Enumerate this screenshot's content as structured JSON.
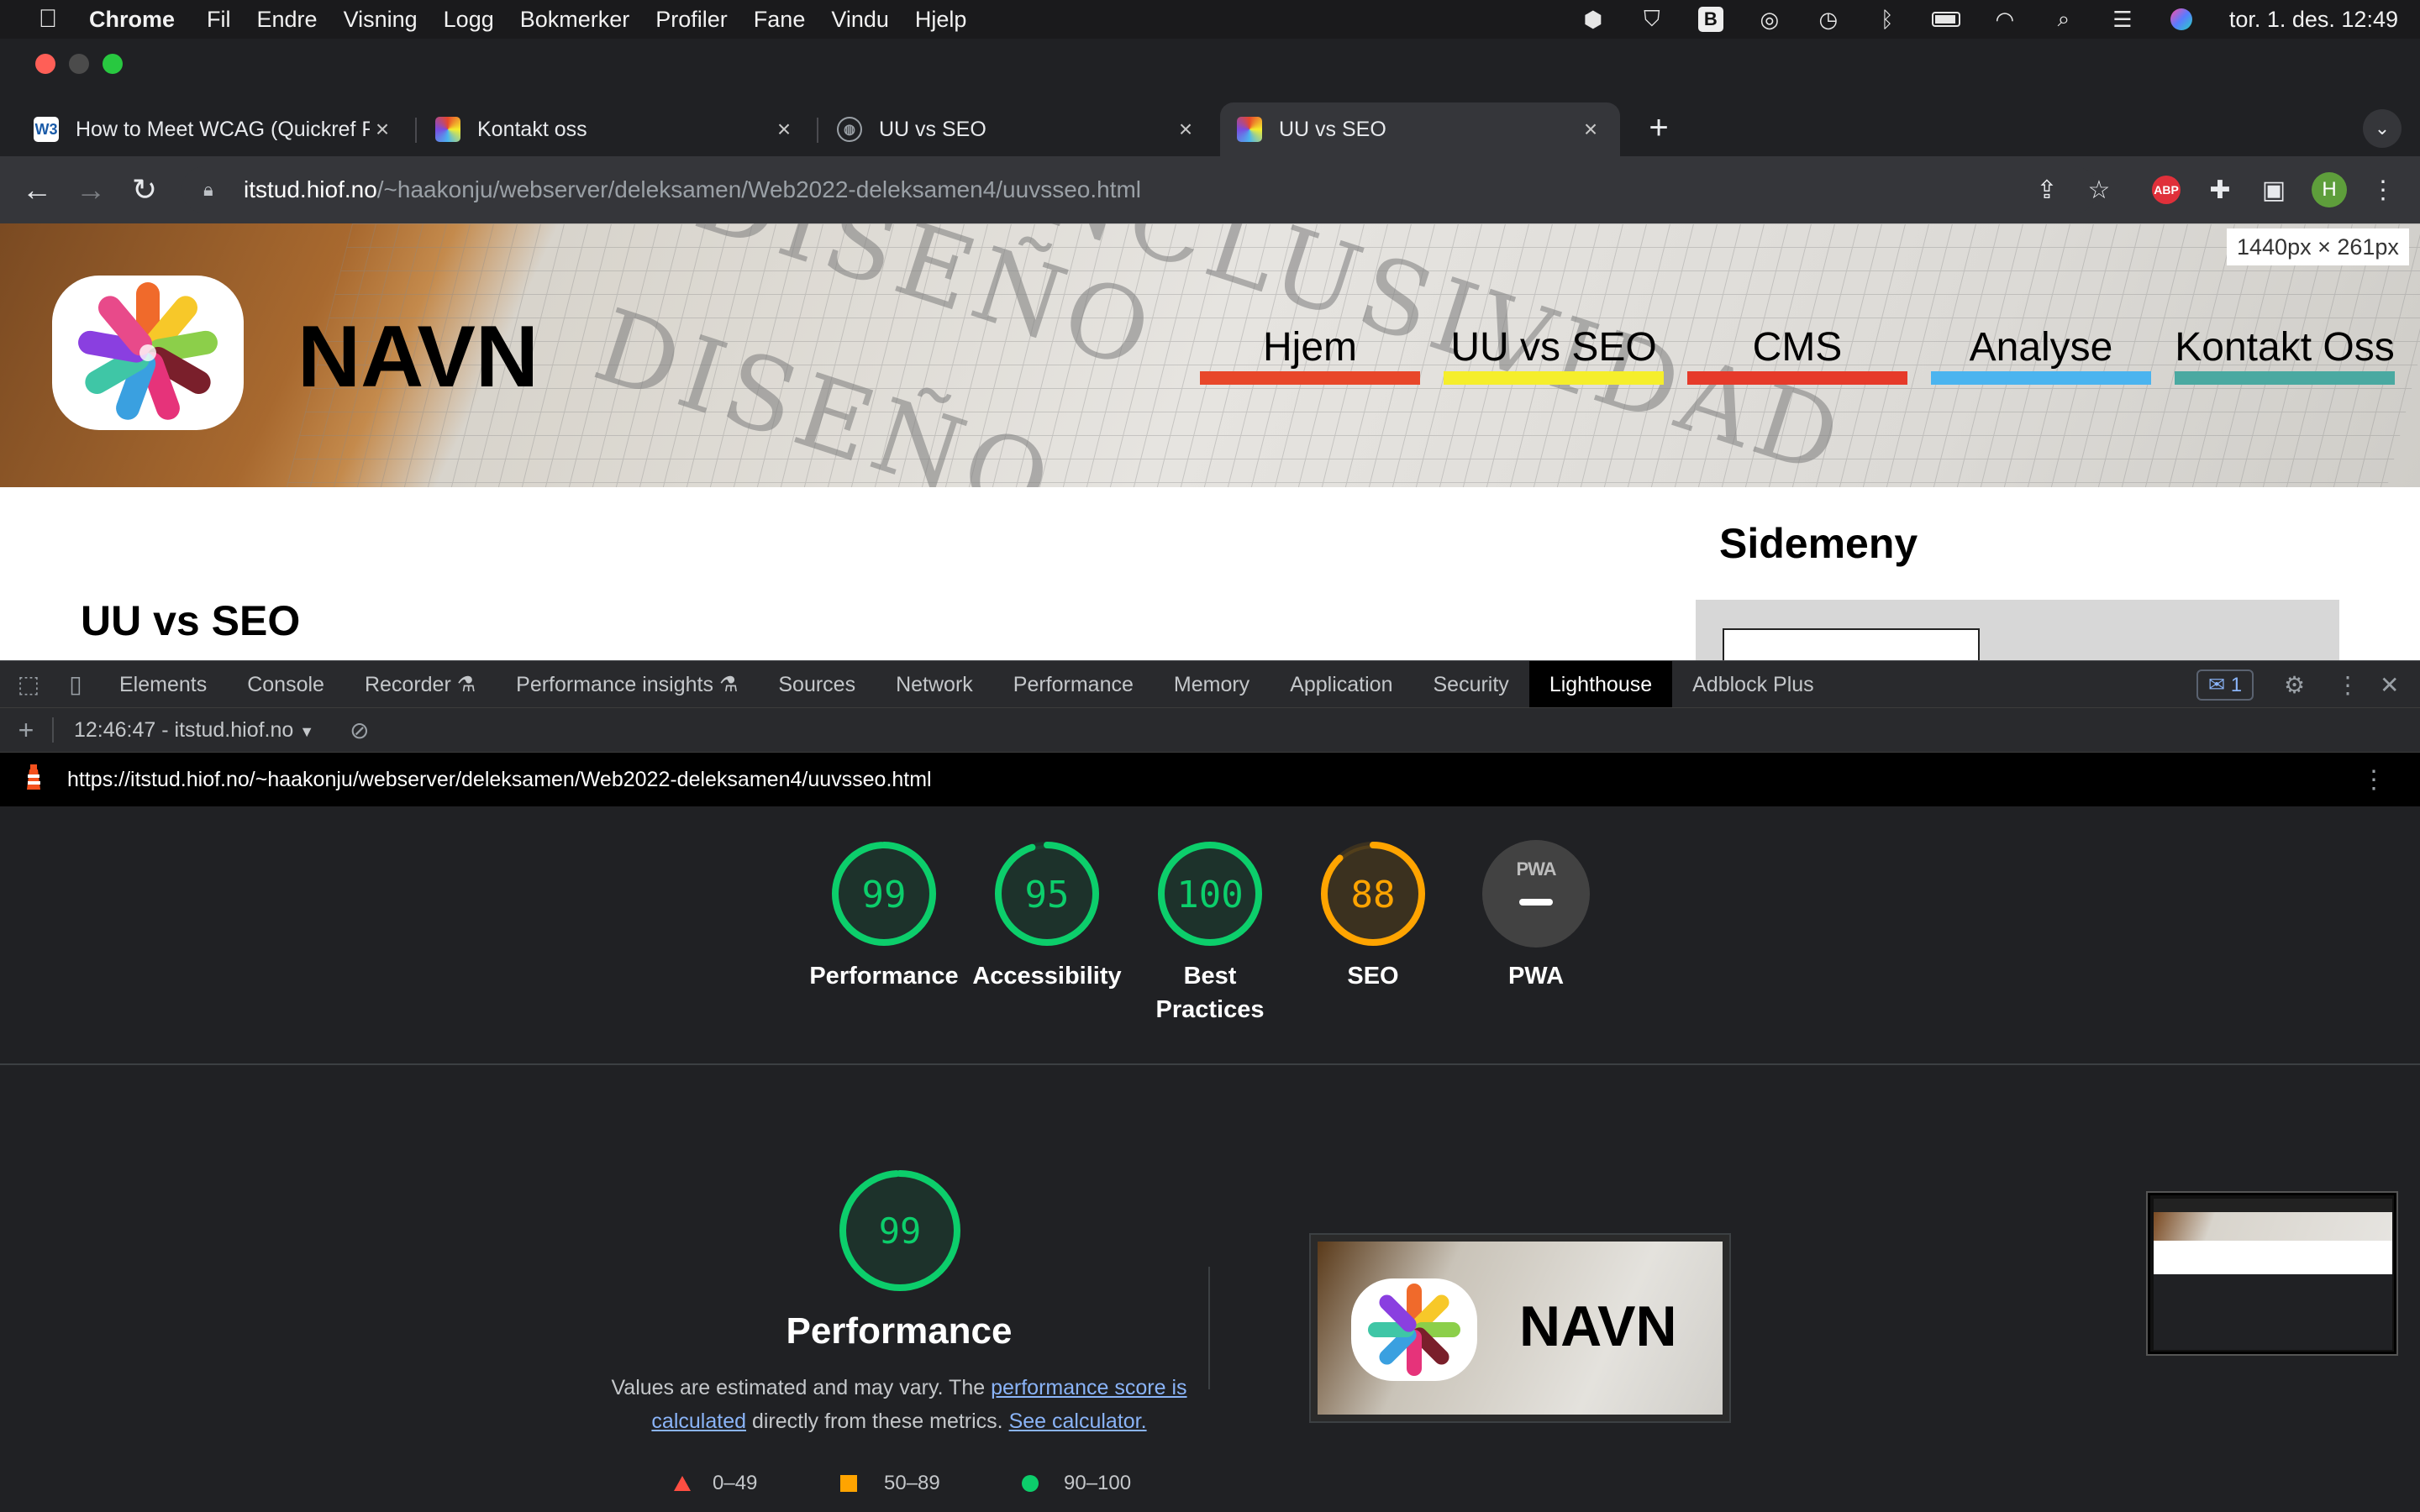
{
  "menubar": {
    "app": "Chrome",
    "items": [
      "Fil",
      "Endre",
      "Visning",
      "Logg",
      "Bokmerker",
      "Profiler",
      "Fane",
      "Vindu",
      "Hjelp"
    ],
    "clock": "tor. 1. des. 12:49"
  },
  "tabs": [
    {
      "label": "How to Meet WCAG (Quickref Reference)",
      "favicon": "W3"
    },
    {
      "label": "Kontakt oss",
      "favicon": ""
    },
    {
      "label": "UU vs SEO",
      "favicon": ""
    },
    {
      "label": "UU vs SEO",
      "favicon": ""
    }
  ],
  "address": {
    "host": "itstud.hiof.no",
    "path": "/~haakonju/webserver/deleksamen/Web2022-deleksamen4/uuvsseo.html",
    "profile_initial": "H",
    "abp_label": "ABP"
  },
  "site": {
    "brand": "NAVN",
    "nav": [
      {
        "label": "Hjem",
        "color": "#e8472a"
      },
      {
        "label": "UU vs SEO",
        "color": "#f5ee2c"
      },
      {
        "label": "CMS",
        "color": "#e63a2a"
      },
      {
        "label": "Analyse",
        "color": "#4bb4ef"
      },
      {
        "label": "Kontakt Oss",
        "color": "#4aa9a1"
      }
    ],
    "size_badge": "1440px × 261px",
    "heading": "UU vs SEO",
    "sidebar_title": "Sidemeny"
  },
  "devtools": {
    "tabs": [
      "Elements",
      "Console",
      "Recorder",
      "Performance insights",
      "Sources",
      "Network",
      "Performance",
      "Memory",
      "Application",
      "Security",
      "Lighthouse",
      "Adblock Plus"
    ],
    "active_tab": "Lighthouse",
    "issues_count": "1",
    "report_selector": "12:46:47 - itstud.hiof.no",
    "report_url": "https://itstud.hiof.no/~haakonju/webserver/deleksamen/Web2022-deleksamen4/uuvsseo.html"
  },
  "lighthouse": {
    "scores": [
      {
        "label": "Performance",
        "value": 99,
        "color": "#0cce6b"
      },
      {
        "label": "Accessibility",
        "value": 95,
        "color": "#0cce6b"
      },
      {
        "label": "Best Practices",
        "value": 100,
        "color": "#0cce6b"
      },
      {
        "label": "SEO",
        "value": 88,
        "color": "#ffa400"
      }
    ],
    "pwa_label": "PWA",
    "pwa_badge": "PWA",
    "performance": {
      "score": 99,
      "title": "Performance",
      "desc_pre": "Values are estimated and may vary. The ",
      "desc_link1": "performance score is calculated",
      "desc_mid": " directly from these metrics. ",
      "desc_link2": "See calculator."
    },
    "legend": [
      {
        "range": "0–49",
        "shape": "triangle",
        "color": "#ff4e42"
      },
      {
        "range": "50–89",
        "shape": "square",
        "color": "#ffa400"
      },
      {
        "range": "90–100",
        "shape": "circle",
        "color": "#0cce6b"
      }
    ],
    "screenshot_brand": "NAVN"
  }
}
